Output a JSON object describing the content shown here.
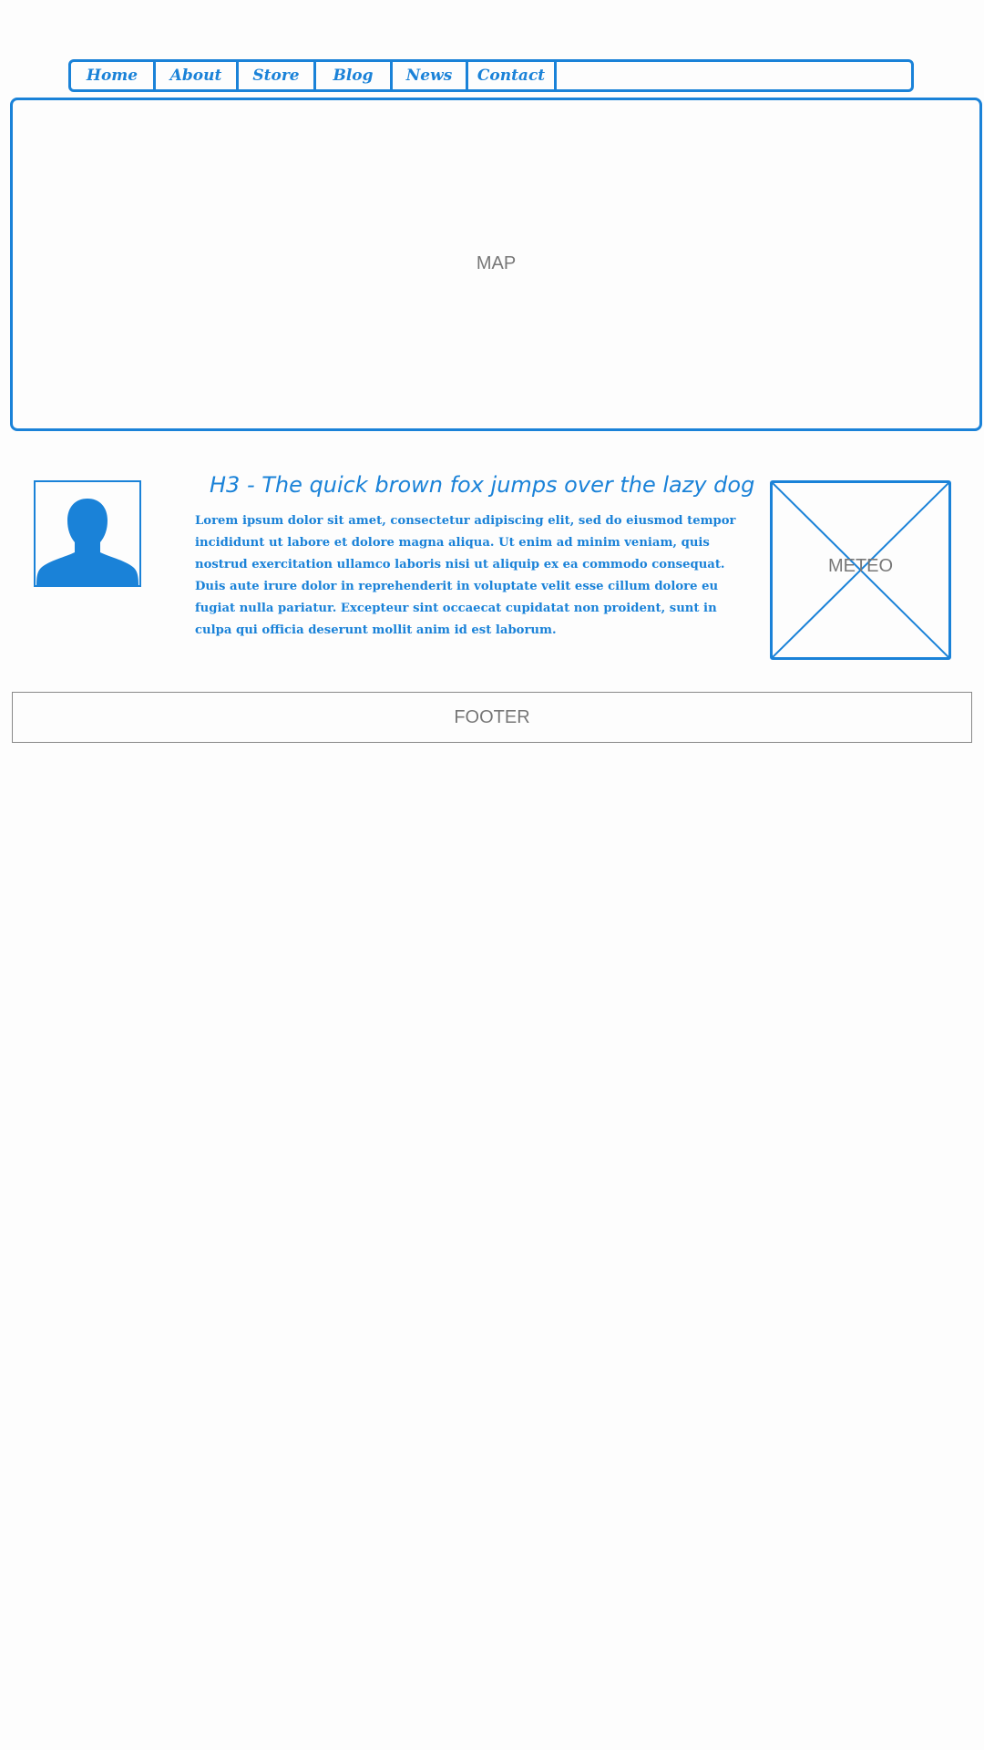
{
  "nav": {
    "items": [
      {
        "label": "Home"
      },
      {
        "label": "About"
      },
      {
        "label": "Store"
      },
      {
        "label": "Blog"
      },
      {
        "label": "News"
      },
      {
        "label": "Contact"
      }
    ]
  },
  "map": {
    "label": "MAP"
  },
  "content": {
    "heading": "H3 - The quick brown fox jumps over the lazy dog",
    "paragraph": "Lorem ipsum dolor sit amet, consectetur adipiscing elit, sed do eiusmod tempor incididunt ut labore et dolore magna aliqua. Ut enim ad minim veniam, quis nostrud exercitation ullamco laboris nisi ut aliquip ex ea commodo consequat. Duis aute irure dolor in reprehenderit in voluptate velit esse cillum dolore eu fugiat nulla pariatur. Excepteur sint occaecat cupidatat non proident, sunt in culpa qui officia deserunt mollit anim id est laborum."
  },
  "avatar": {
    "icon": "user-silhouette-icon"
  },
  "meteo": {
    "label": "METEO",
    "icon": "image-placeholder-icon"
  },
  "footer": {
    "label": "FOOTER"
  },
  "colors": {
    "accent": "#1a82d8",
    "label_gray": "#777777"
  }
}
